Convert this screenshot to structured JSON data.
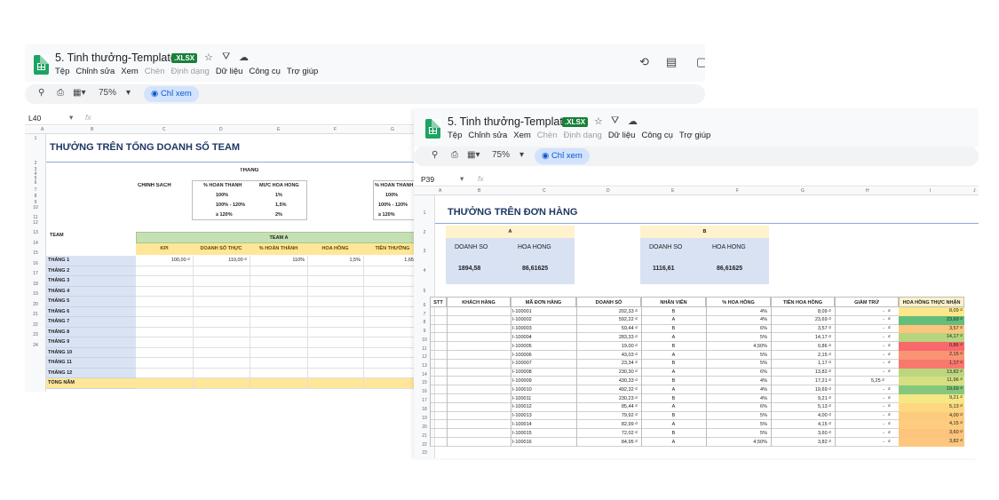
{
  "windows": [
    {
      "title": "5. Tinh thưởng-Template",
      "badge": ".XLSX",
      "menu": [
        "Tệp",
        "Chỉnh sửa",
        "Xem",
        "Chèn",
        "Định dạng",
        "Dữ liệu",
        "Công cụ",
        "Trợ giúp"
      ],
      "zoom": "75%",
      "view_label": "Chỉ xem",
      "cell_ref": "L40"
    },
    {
      "title": "5. Tinh thưởng-Template",
      "badge": ".XLSX",
      "menu": [
        "Tệp",
        "Chỉnh sửa",
        "Xem",
        "Chèn",
        "Định dạng",
        "Dữ liệu",
        "Công cụ",
        "Trợ giúp"
      ],
      "zoom": "75%",
      "view_label": "Chỉ xem",
      "cell_ref": "P39"
    }
  ],
  "colors": {
    "accent_green": "#188038",
    "view_blue": "#d3e3fd",
    "header_green": "#c5e0b4",
    "header_yellow": "#ffe699",
    "month_blue": "#dae3f3",
    "summary_blue": "#d9e2f3",
    "summary_yellow": "#fff2cc"
  },
  "sheet1": {
    "col_letters": [
      "A",
      "B",
      "C",
      "D",
      "E",
      "F",
      "G"
    ],
    "title": "THƯỞNG TRÊN TỔNG DOANH SỐ TEAM",
    "policy_label": "CHÍNH SÁCH",
    "month_label": "THÁNG",
    "policy_headers": [
      "% HOÀN THÀNH",
      "MỨC HOA HỒNG"
    ],
    "policy_rows": [
      [
        "100%",
        "1%"
      ],
      [
        "100% - 120%",
        "1,5%"
      ],
      [
        "≥ 120%",
        "2%"
      ]
    ],
    "policy2_header": "% HOÀN THÀNH",
    "policy2_rows": [
      "100%",
      "100% - 120%",
      "≥ 120%"
    ],
    "team_label": "TEAM",
    "team_a": "TEAM A",
    "team_headers": [
      "KPI",
      "DOANH SỐ THỰC",
      "% HOÀN THÀNH",
      "HOA HỒNG",
      "TIỀN THƯỞNG"
    ],
    "months": [
      "THÁNG 1",
      "THÁNG 2",
      "THÁNG 3",
      "THÁNG 4",
      "THÁNG 5",
      "THÁNG 6",
      "THÁNG 7",
      "THÁNG 8",
      "THÁNG 9",
      "THÁNG 10",
      "THÁNG 11",
      "THÁNG 12",
      "TỔNG NĂM"
    ],
    "month1_values": [
      "100,00 ₫",
      "110,00 ₫",
      "110%",
      "1,5%",
      "1,65"
    ],
    "row_numbers": [
      "1",
      "2",
      "3",
      "4",
      "5",
      "6",
      "7",
      "8",
      "9",
      "10",
      "11",
      "12",
      "13",
      "14",
      "15",
      "16",
      "17",
      "18",
      "19",
      "20",
      "21",
      "22",
      "23",
      "24"
    ]
  },
  "sheet2": {
    "col_letters": [
      "A",
      "B",
      "C",
      "D",
      "E",
      "F",
      "G",
      "H",
      "I",
      "J"
    ],
    "title": "THƯỞNG TRÊN ĐƠN HÀNG",
    "summary": [
      {
        "name": "A",
        "labels": [
          "DOANH SỐ",
          "HOA HỒNG"
        ],
        "values": [
          "1894,58",
          "86,61625"
        ]
      },
      {
        "name": "B",
        "labels": [
          "DOANH SỐ",
          "HOA HỒNG"
        ],
        "values": [
          "1116,61",
          "86,61625"
        ]
      }
    ],
    "table_headers": [
      "STT",
      "KHÁCH HÀNG",
      "MÃ ĐƠN HÀNG",
      "DOANH SỐ",
      "NHÂN VIÊN",
      "% HOA HỒNG",
      "TIỀN HOA HỒNG",
      "GIẢM TRỪ",
      "HOA HỒNG THỰC NHẬN"
    ],
    "rows": [
      [
        "I-100001",
        "202,33 ₫",
        "B",
        "4%",
        "8,09 ₫",
        "-",
        "₫",
        "8,09 ₫",
        "#fbe88a"
      ],
      [
        "I-100002",
        "592,22 ₫",
        "A",
        "4%",
        "23,69 ₫",
        "-",
        "₫",
        "23,69 ₫",
        "#63be7b"
      ],
      [
        "I-100003",
        "59,44 ₫",
        "B",
        "6%",
        "3,57 ₫",
        "-",
        "₫",
        "3,57 ₫",
        "#fdc47d"
      ],
      [
        "I-100004",
        "283,33 ₫",
        "A",
        "5%",
        "14,17 ₫",
        "-",
        "₫",
        "14,17 ₫",
        "#b5d67f"
      ],
      [
        "I-100005",
        "19,00 ₫",
        "B",
        "4,50%",
        "0,86 ₫",
        "-",
        "₫",
        "0,86 ₫",
        "#f8696b"
      ],
      [
        "I-100006",
        "43,03 ₫",
        "A",
        "5%",
        "2,15 ₫",
        "-",
        "₫",
        "2,15 ₫",
        "#fa9474"
      ],
      [
        "I-100007",
        "23,34 ₫",
        "B",
        "5%",
        "1,17 ₫",
        "-",
        "₫",
        "1,17 ₫",
        "#f8786e"
      ],
      [
        "I-100008",
        "230,30 ₫",
        "A",
        "6%",
        "13,82 ₫",
        "-",
        "₫",
        "13,82 ₫",
        "#bad780"
      ],
      [
        "I-100009",
        "430,33 ₫",
        "B",
        "4%",
        "17,21 ₫",
        "5,25 ₫",
        "",
        "11,96 ₫",
        "#d6df82"
      ],
      [
        "I-100010",
        "492,32 ₫",
        "A",
        "4%",
        "19,69 ₫",
        "-",
        "₫",
        "19,69 ₫",
        "#85c87d"
      ],
      [
        "I-100011",
        "230,23 ₫",
        "B",
        "4%",
        "9,21 ₫",
        "-",
        "₫",
        "9,21 ₫",
        "#f5e784"
      ],
      [
        "I-100012",
        "85,44 ₫",
        "A",
        "6%",
        "5,13 ₫",
        "-",
        "₫",
        "5,13 ₫",
        "#fed880"
      ],
      [
        "I-100013",
        "79,92 ₫",
        "B",
        "5%",
        "4,00 ₫",
        "-",
        "₫",
        "4,00 ₫",
        "#fdcb7e"
      ],
      [
        "I-100014",
        "82,99 ₫",
        "A",
        "5%",
        "4,15 ₫",
        "-",
        "₫",
        "4,15 ₫",
        "#fdcc7e"
      ],
      [
        "I-100015",
        "72,02 ₫",
        "B",
        "5%",
        "3,60 ₫",
        "-",
        "₫",
        "3,60 ₫",
        "#fdc47d"
      ],
      [
        "I-100016",
        "84,95 ₫",
        "A",
        "4,50%",
        "3,82 ₫",
        "-",
        "₫",
        "3,82 ₫",
        "#fdc77d"
      ]
    ],
    "row_numbers": [
      "1",
      "2",
      "3",
      "4",
      "5",
      "6",
      "7",
      "8",
      "9",
      "10",
      "11",
      "12",
      "13",
      "14",
      "15",
      "16",
      "17",
      "18",
      "19",
      "20",
      "21",
      "22",
      "23"
    ]
  }
}
